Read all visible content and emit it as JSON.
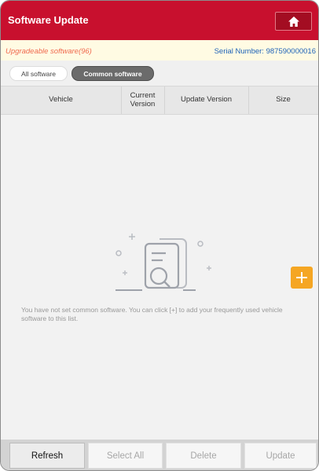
{
  "header": {
    "title": "Software Update",
    "home_icon": "home-icon",
    "color": "#c8102e"
  },
  "info_bar": {
    "upgradeable": "Upgradeable software(96)",
    "serial_label": "Serial Number:",
    "serial_value": "987590000016"
  },
  "tabs": [
    {
      "label": "All software",
      "active": false
    },
    {
      "label": "Common software",
      "active": true
    }
  ],
  "table": {
    "columns": [
      "Vehicle",
      "Current\nVersion",
      "Update Version",
      "Size"
    ],
    "rows": []
  },
  "empty_state": {
    "illustration_icon": "documents-search-icon",
    "message": "You have not set common software. You can click [+] to add your frequently used vehicle software to this list."
  },
  "add_button": {
    "icon": "plus-icon",
    "color": "#f5a623"
  },
  "toolbar": {
    "buttons": [
      {
        "label": "Refresh",
        "enabled": true
      },
      {
        "label": "Select All",
        "enabled": false
      },
      {
        "label": "Delete",
        "enabled": false
      },
      {
        "label": "Update",
        "enabled": false
      }
    ]
  }
}
